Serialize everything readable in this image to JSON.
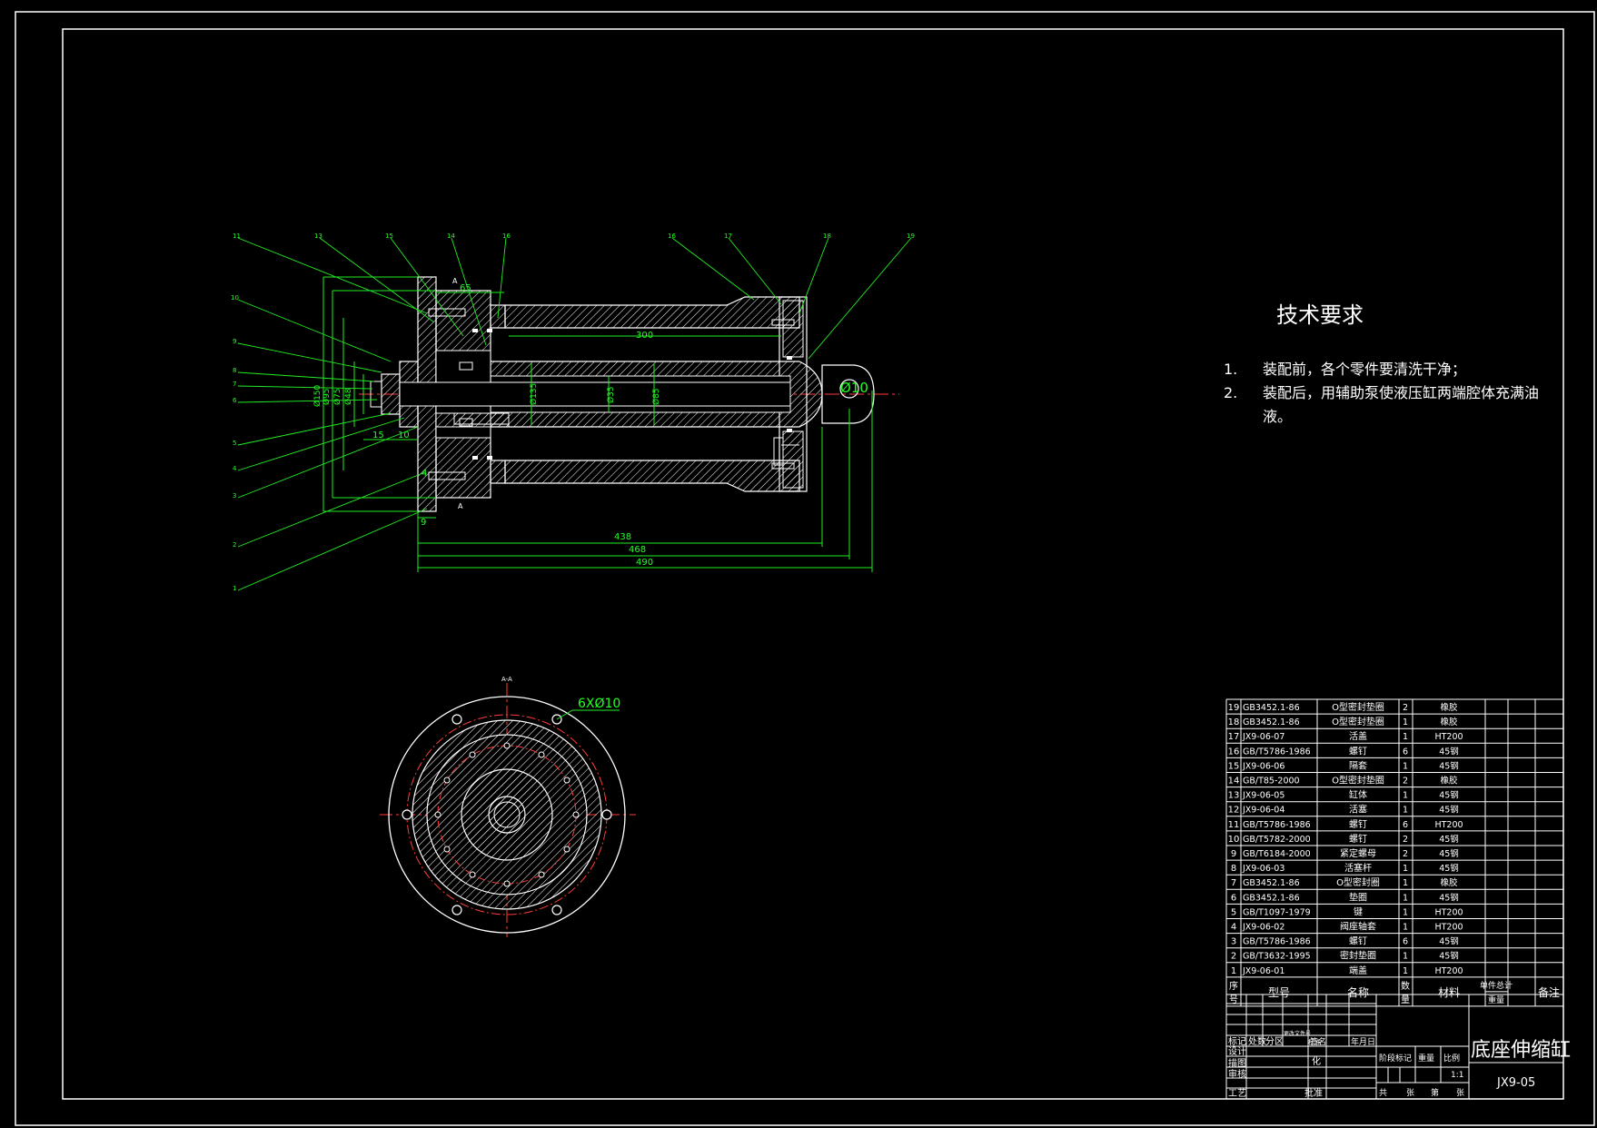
{
  "tech": {
    "title": "技术要求",
    "items": [
      {
        "num": "1.",
        "text": "装配前，各个零件要清洗干净；"
      },
      {
        "num": "2.",
        "text": "装配后，用辅助泵使液压缸两端腔体充满油"
      },
      {
        "num": "",
        "text": "液。"
      }
    ]
  },
  "dims": {
    "d65": "65",
    "d300": "300",
    "d438": "438",
    "d468": "468",
    "d490": "490",
    "d15": "15",
    "d10": "10",
    "d9": "9",
    "d4": "4",
    "phi10": "Ø10",
    "phi_a": "Ø135",
    "phi_b": "Ø35",
    "phi_c": "Ø85",
    "phi_d": "Ø150",
    "phi_e": "Ø95",
    "phi_f": "Ø75",
    "phi_g": "Ø48"
  },
  "section": {
    "label_top": "A",
    "label_bottom": "A",
    "view_label": "A-A",
    "holes": "6XØ10"
  },
  "leaders": [
    "11",
    "13",
    "15",
    "14",
    "16",
    "16",
    "17",
    "18",
    "19",
    "10",
    "9",
    "8",
    "7",
    "6",
    "5",
    "4",
    "3",
    "2",
    "1"
  ],
  "bom": {
    "rows": [
      {
        "no": "19",
        "code": "GB3452.1-86",
        "name": "O型密封垫圈",
        "qty": "2",
        "mat": "橡胶"
      },
      {
        "no": "18",
        "code": "GB3452.1-86",
        "name": "O型密封垫圈",
        "qty": "1",
        "mat": "橡胶"
      },
      {
        "no": "17",
        "code": "JX9-06-07",
        "name": "活盖",
        "qty": "1",
        "mat": "HT200"
      },
      {
        "no": "16",
        "code": "GB/T5786-1986",
        "name": "螺钉",
        "qty": "6",
        "mat": "45钢"
      },
      {
        "no": "15",
        "code": "JX9-06-06",
        "name": "隔套",
        "qty": "1",
        "mat": "45钢"
      },
      {
        "no": "14",
        "code": "GB/T85-2000",
        "name": "O型密封垫圈",
        "qty": "2",
        "mat": "橡胶"
      },
      {
        "no": "13",
        "code": "JX9-06-05",
        "name": "缸体",
        "qty": "1",
        "mat": "45钢"
      },
      {
        "no": "12",
        "code": "JX9-06-04",
        "name": "活塞",
        "qty": "1",
        "mat": "45钢"
      },
      {
        "no": "11",
        "code": "GB/T5786-1986",
        "name": "螺钉",
        "qty": "6",
        "mat": "HT200"
      },
      {
        "no": "10",
        "code": "GB/T5782-2000",
        "name": "螺钉",
        "qty": "2",
        "mat": "45钢"
      },
      {
        "no": "9",
        "code": "GB/T6184-2000",
        "name": "紧定螺母",
        "qty": "2",
        "mat": "45钢"
      },
      {
        "no": "8",
        "code": "JX9-06-03",
        "name": "活塞杆",
        "qty": "1",
        "mat": "45钢"
      },
      {
        "no": "7",
        "code": "GB3452.1-86",
        "name": "O型密封圈",
        "qty": "1",
        "mat": "橡胶"
      },
      {
        "no": "6",
        "code": "GB3452.1-86",
        "name": "垫圈",
        "qty": "1",
        "mat": "45钢"
      },
      {
        "no": "5",
        "code": "GB/T1097-1979",
        "name": "键",
        "qty": "1",
        "mat": "HT200"
      },
      {
        "no": "4",
        "code": "JX9-06-02",
        "name": "阀座轴套",
        "qty": "1",
        "mat": "HT200"
      },
      {
        "no": "3",
        "code": "GB/T5786-1986",
        "name": "螺钉",
        "qty": "6",
        "mat": "45钢"
      },
      {
        "no": "2",
        "code": "GB/T3632-1995",
        "name": "密封垫圈",
        "qty": "1",
        "mat": "45钢"
      },
      {
        "no": "1",
        "code": "JX9-06-01",
        "name": "端盖",
        "qty": "1",
        "mat": "HT200"
      }
    ],
    "header": {
      "seq1": "序",
      "seq2": "号",
      "code": "型号",
      "name": "名称",
      "qty1": "数",
      "qty2": "量",
      "mat": "材料",
      "w1": "单件总计",
      "w2": "重量",
      "note": "备注"
    }
  },
  "titleblock": {
    "title": "底座伸缩缸",
    "drawing_no": "JX9-05",
    "r_biaoji": "标记",
    "r_chushu": "处数",
    "r_fenqu": "分区",
    "r_wenjian": "更改文件号",
    "r_qianming": "签名",
    "r_date": "年月日",
    "r_sheji": "设计",
    "r_biaozhunhua1": "标准",
    "r_biaozhunhua2": "化",
    "r_jieduan": "阶段标记",
    "r_zhongliang": "重量",
    "r_bili": "比例",
    "r_scale": "1:1",
    "r_jiaotu": "描图",
    "r_shenhe": "审核",
    "r_gongyi": "工艺",
    "r_pizhun": "批准",
    "r_gong": "共",
    "r_zhang1": "张",
    "r_di": "第",
    "r_zhang2": "张"
  }
}
